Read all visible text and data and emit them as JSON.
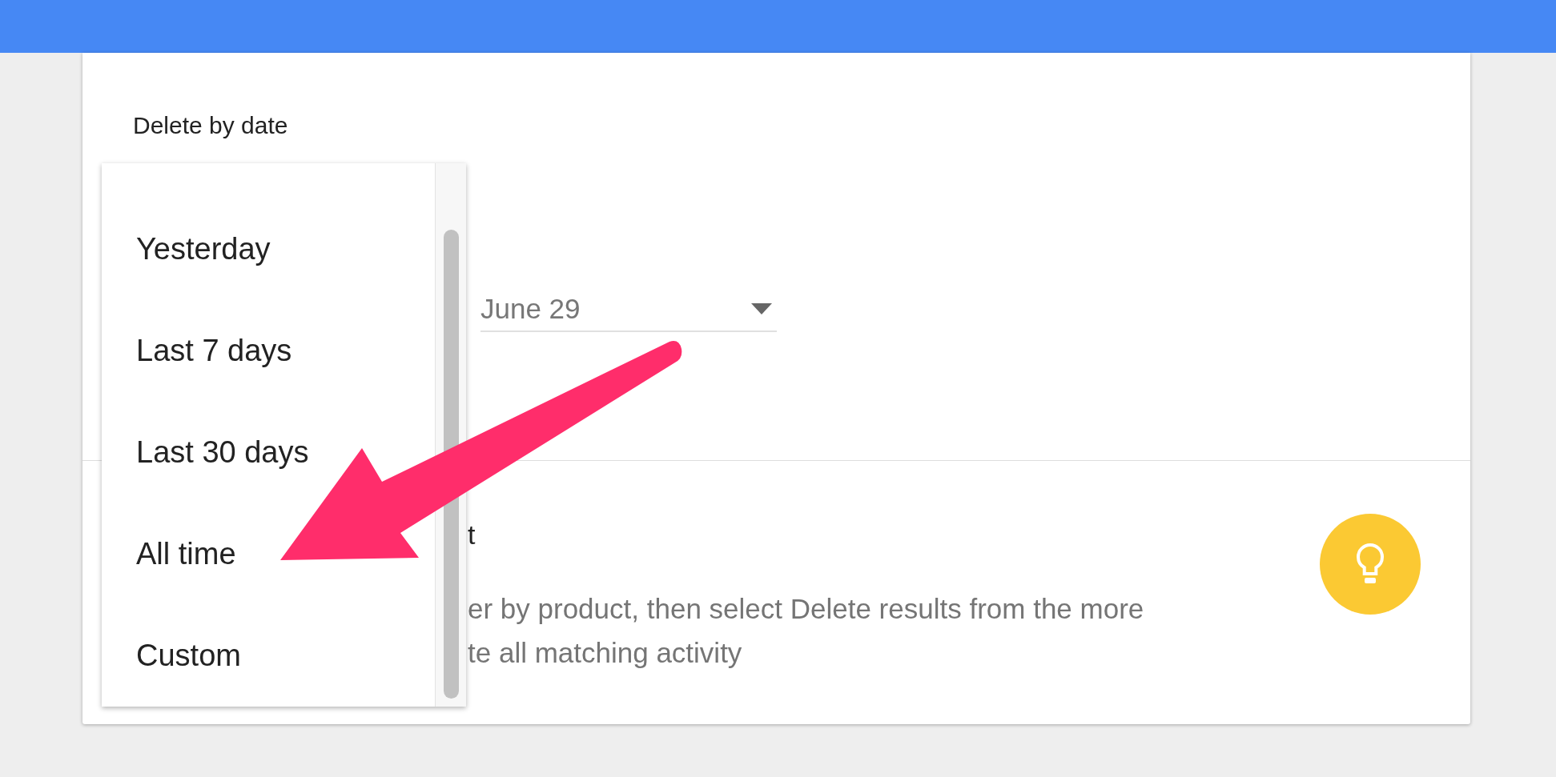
{
  "section_title": "Delete by date",
  "date_dropdown": {
    "value": "June 29"
  },
  "date_range_menu": {
    "items": [
      {
        "label": "Yesterday"
      },
      {
        "label": "Last 7 days"
      },
      {
        "label": "Last 30 days"
      },
      {
        "label": "All time"
      },
      {
        "label": "Custom"
      }
    ]
  },
  "tip": {
    "title": "t",
    "lines": [
      "er by product, then select Delete results from the more",
      "te all matching activity"
    ]
  }
}
